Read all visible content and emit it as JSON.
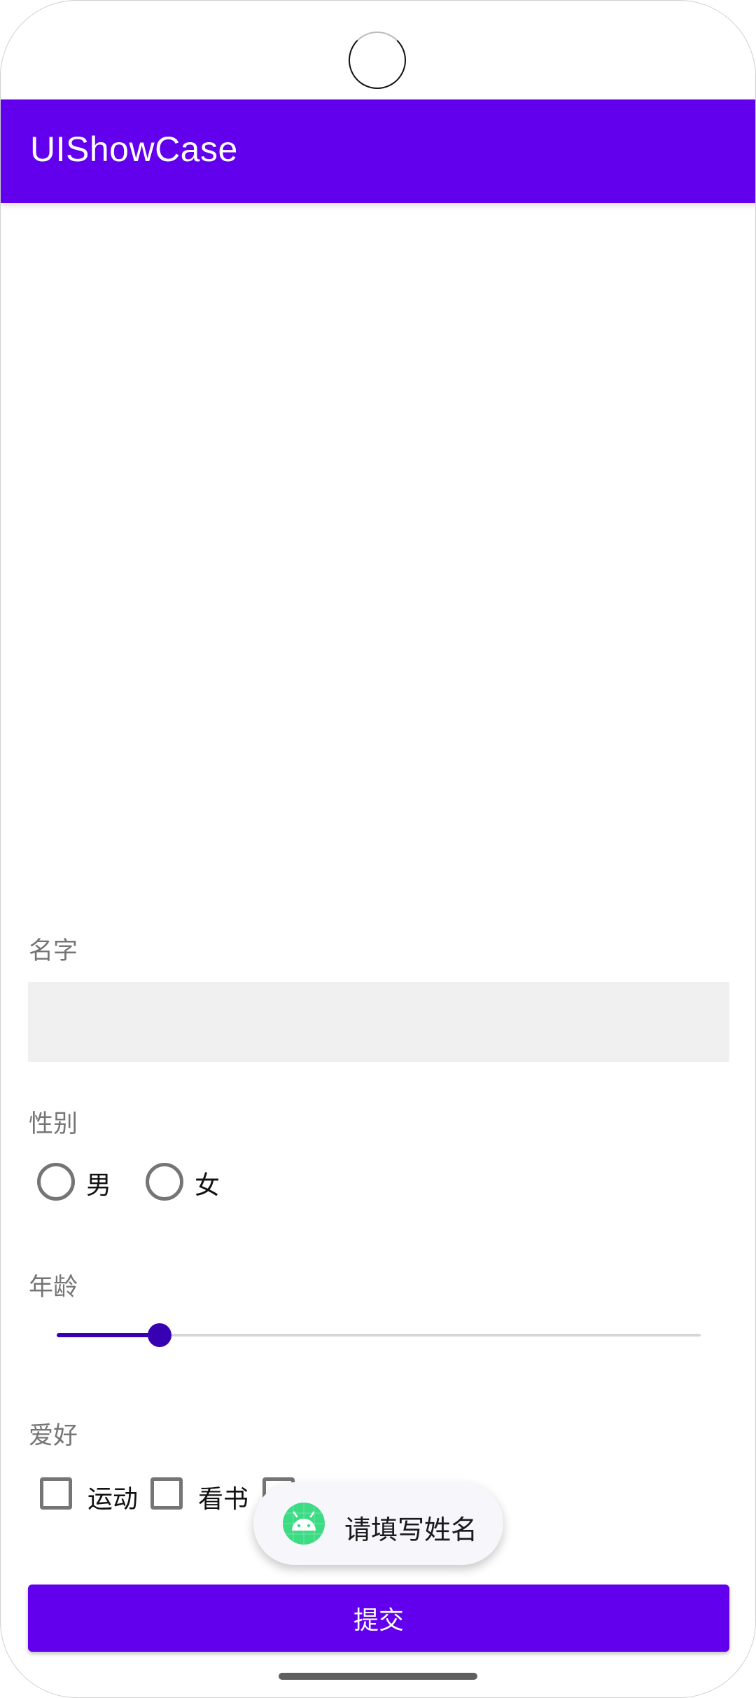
{
  "app_bar": {
    "title": "UIShowCase",
    "color": "#6200ee"
  },
  "form": {
    "name": {
      "label": "名字",
      "value": ""
    },
    "gender": {
      "label": "性别",
      "options": [
        {
          "label": "男",
          "selected": false
        },
        {
          "label": "女",
          "selected": false
        }
      ]
    },
    "age": {
      "label": "年龄",
      "slider_fraction": 0.16
    },
    "hobbies": {
      "label": "爱好",
      "options": [
        {
          "label": "运动",
          "checked": false
        },
        {
          "label": "看书",
          "checked": false
        },
        {
          "label": "",
          "checked": false
        }
      ]
    },
    "submit_label": "提交"
  },
  "toast": {
    "message": "请填写姓名",
    "icon": "android-icon"
  },
  "colors": {
    "primary": "#6200ee",
    "slider_accent": "#3700b3",
    "toast_icon": "#3ddc84"
  }
}
